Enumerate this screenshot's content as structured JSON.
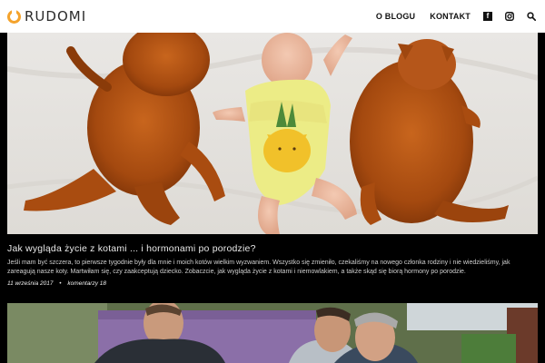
{
  "header": {
    "logo_text": "RUDOMI",
    "nav": [
      {
        "label": "O BLOGU"
      },
      {
        "label": "KONTAKT"
      }
    ],
    "social": [
      "facebook-icon",
      "instagram-icon"
    ],
    "search_icon": "search-icon"
  },
  "article": {
    "title": "Jak wygląda życie z kotami ... i hormonami po porodzie?",
    "excerpt": "Jeśli mam być szczera, to pierwsze tygodnie były dla mnie i moich kotów wielkim wyzwaniem. Wszystko się zmieniło, czekaliśmy na nowego członka rodziny i nie wiedzieliśmy, jak zareagują nasze koty. Martwiłam się, czy zaakceptują dziecko. Zobaczcie, jak wygląda życie z kotami i niemowlakiem, a także skąd się biorą hormony po porodzie.",
    "date": "11 września 2017",
    "comments": "komentarzy 18"
  },
  "colors": {
    "accent": "#f4a32c",
    "header_bg": "#ffffff",
    "page_bg": "#000000"
  }
}
